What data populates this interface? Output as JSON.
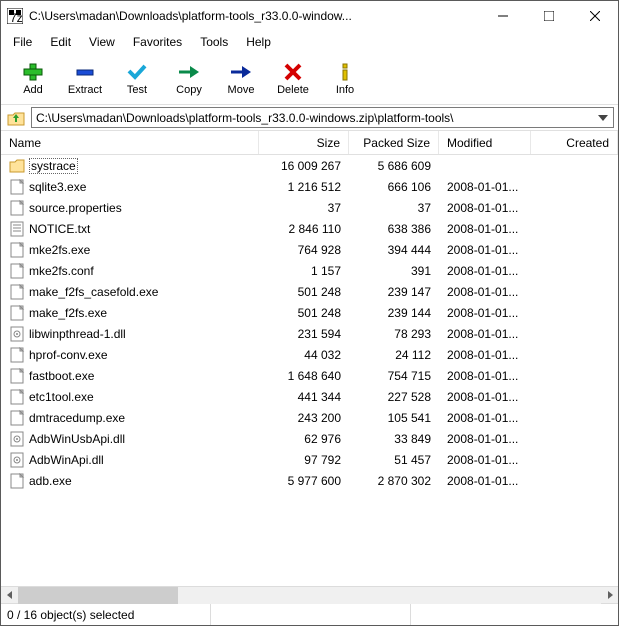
{
  "titlebar": {
    "title": "C:\\Users\\madan\\Downloads\\platform-tools_r33.0.0-window..."
  },
  "menu": {
    "file": "File",
    "edit": "Edit",
    "view": "View",
    "favorites": "Favorites",
    "tools": "Tools",
    "help": "Help"
  },
  "toolbar": {
    "add": "Add",
    "extract": "Extract",
    "test": "Test",
    "copy": "Copy",
    "move": "Move",
    "delete": "Delete",
    "info": "Info"
  },
  "address": {
    "path": "C:\\Users\\madan\\Downloads\\platform-tools_r33.0.0-windows.zip\\platform-tools\\"
  },
  "columns": {
    "name": "Name",
    "size": "Size",
    "packed": "Packed Size",
    "modified": "Modified",
    "created": "Created"
  },
  "files": [
    {
      "icon": "folder",
      "name": "systrace",
      "size": "16 009 267",
      "packed": "5 686 609",
      "modified": ""
    },
    {
      "icon": "exe",
      "name": "sqlite3.exe",
      "size": "1 216 512",
      "packed": "666 106",
      "modified": "2008-01-01..."
    },
    {
      "icon": "file",
      "name": "source.properties",
      "size": "37",
      "packed": "37",
      "modified": "2008-01-01..."
    },
    {
      "icon": "txt",
      "name": "NOTICE.txt",
      "size": "2 846 110",
      "packed": "638 386",
      "modified": "2008-01-01..."
    },
    {
      "icon": "exe",
      "name": "mke2fs.exe",
      "size": "764 928",
      "packed": "394 444",
      "modified": "2008-01-01..."
    },
    {
      "icon": "file",
      "name": "mke2fs.conf",
      "size": "1 157",
      "packed": "391",
      "modified": "2008-01-01..."
    },
    {
      "icon": "exe",
      "name": "make_f2fs_casefold.exe",
      "size": "501 248",
      "packed": "239 147",
      "modified": "2008-01-01..."
    },
    {
      "icon": "exe",
      "name": "make_f2fs.exe",
      "size": "501 248",
      "packed": "239 144",
      "modified": "2008-01-01..."
    },
    {
      "icon": "dll",
      "name": "libwinpthread-1.dll",
      "size": "231 594",
      "packed": "78 293",
      "modified": "2008-01-01..."
    },
    {
      "icon": "exe",
      "name": "hprof-conv.exe",
      "size": "44 032",
      "packed": "24 112",
      "modified": "2008-01-01..."
    },
    {
      "icon": "exe",
      "name": "fastboot.exe",
      "size": "1 648 640",
      "packed": "754 715",
      "modified": "2008-01-01..."
    },
    {
      "icon": "exe",
      "name": "etc1tool.exe",
      "size": "441 344",
      "packed": "227 528",
      "modified": "2008-01-01..."
    },
    {
      "icon": "exe",
      "name": "dmtracedump.exe",
      "size": "243 200",
      "packed": "105 541",
      "modified": "2008-01-01..."
    },
    {
      "icon": "dll",
      "name": "AdbWinUsbApi.dll",
      "size": "62 976",
      "packed": "33 849",
      "modified": "2008-01-01..."
    },
    {
      "icon": "dll",
      "name": "AdbWinApi.dll",
      "size": "97 792",
      "packed": "51 457",
      "modified": "2008-01-01..."
    },
    {
      "icon": "exe",
      "name": "adb.exe",
      "size": "5 977 600",
      "packed": "2 870 302",
      "modified": "2008-01-01..."
    }
  ],
  "status": {
    "selection": "0 / 16 object(s) selected"
  }
}
